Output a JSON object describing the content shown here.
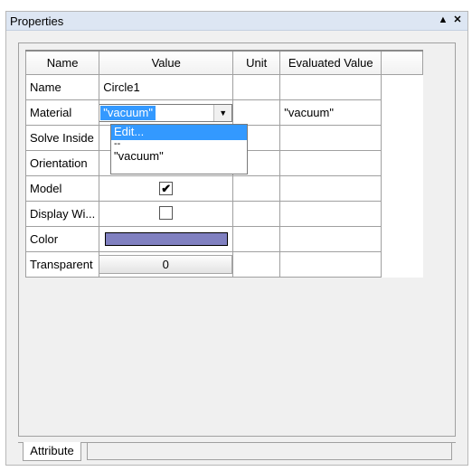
{
  "panel": {
    "title": "Properties",
    "pin_icon": "pin-icon",
    "close_icon": "close-icon"
  },
  "columns": {
    "name": "Name",
    "value": "Value",
    "unit": "Unit",
    "evaluated": "Evaluated Value"
  },
  "rows": {
    "name": {
      "name": "Name",
      "value": "Circle1"
    },
    "material": {
      "name": "Material",
      "value": "\"vacuum\"",
      "evaluated": "\"vacuum\""
    },
    "solve_inside": {
      "name": "Solve Inside"
    },
    "orientation": {
      "name": "Orientation"
    },
    "model": {
      "name": "Model",
      "checked": true
    },
    "display_wireframe": {
      "name": "Display Wi...",
      "checked": false
    },
    "color": {
      "name": "Color",
      "swatch_color": "#8080c0"
    },
    "transparent": {
      "name": "Transparent",
      "value": "0"
    }
  },
  "material_dropdown": {
    "options": [
      "Edit...",
      "--",
      "\"vacuum\""
    ],
    "highlighted": "Edit..."
  },
  "tabs": {
    "attribute": "Attribute"
  },
  "colors": {
    "selection": "#3399ff",
    "titlebar": "#dde6f3"
  }
}
